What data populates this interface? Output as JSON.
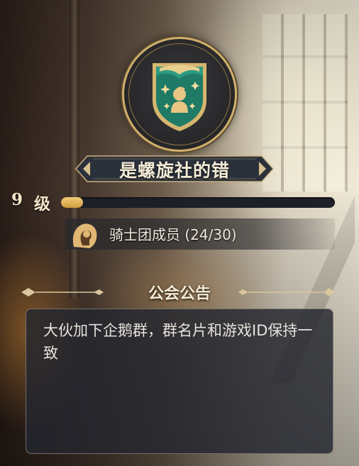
{
  "guild": {
    "name": "是螺旋社的错",
    "emblem_icon": "guild-shield-emblem-icon"
  },
  "level": {
    "number": "9",
    "unit": "级",
    "progress": 0.08
  },
  "membership": {
    "icon": "member-silhouette-icon",
    "text": "骑士团成员 (24/30)"
  },
  "announcement": {
    "title": "公会公告",
    "text": "大伙加下企鹅群，群名片和游戏ID保持一致"
  },
  "colors": {
    "accent_gold": "#cfae6a",
    "bar_fill": "#e2b35a",
    "shield_green": "#1f7a66"
  }
}
